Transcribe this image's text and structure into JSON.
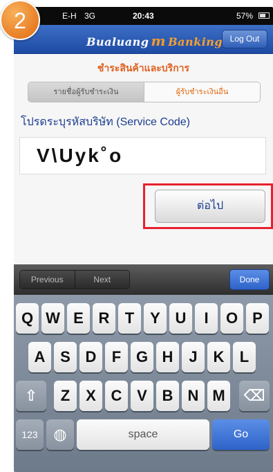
{
  "step_badge": "2",
  "status_bar": {
    "carrier": "E-H",
    "network": "3G",
    "time": "20:43",
    "battery": "57%"
  },
  "header": {
    "logo_left": "Bualuang",
    "logo_mid": "m",
    "logo_right": "Banking",
    "logout_label": "Log Out"
  },
  "page": {
    "title": "ชำระสินค้าและบริการ",
    "tabs": [
      {
        "label": "รายชื่อผู้รับชำระเงิน"
      },
      {
        "label": "ผู้รับชำระเงินอื่น"
      }
    ],
    "field_label": "โปรดระบุรหัสบริษัท (Service Code)",
    "input_value": "V\\Uyk˚o",
    "next_label": "ต่อไป"
  },
  "accessory": {
    "previous": "Previous",
    "next": "Next",
    "done": "Done"
  },
  "keyboard": {
    "row1": [
      "Q",
      "W",
      "E",
      "R",
      "T",
      "Y",
      "U",
      "I",
      "O",
      "P"
    ],
    "row2": [
      "A",
      "S",
      "D",
      "F",
      "G",
      "H",
      "J",
      "K",
      "L"
    ],
    "row3": [
      "Z",
      "X",
      "C",
      "V",
      "B",
      "N",
      "M"
    ],
    "shift_glyph": "⇧",
    "delete_glyph": "⌫",
    "numbers": "123",
    "globe_glyph": "◍",
    "space": "space",
    "go": "Go"
  },
  "colors": {
    "accent": "#e06020",
    "brand": "#1e4aa3",
    "highlight": "#e8202e"
  }
}
